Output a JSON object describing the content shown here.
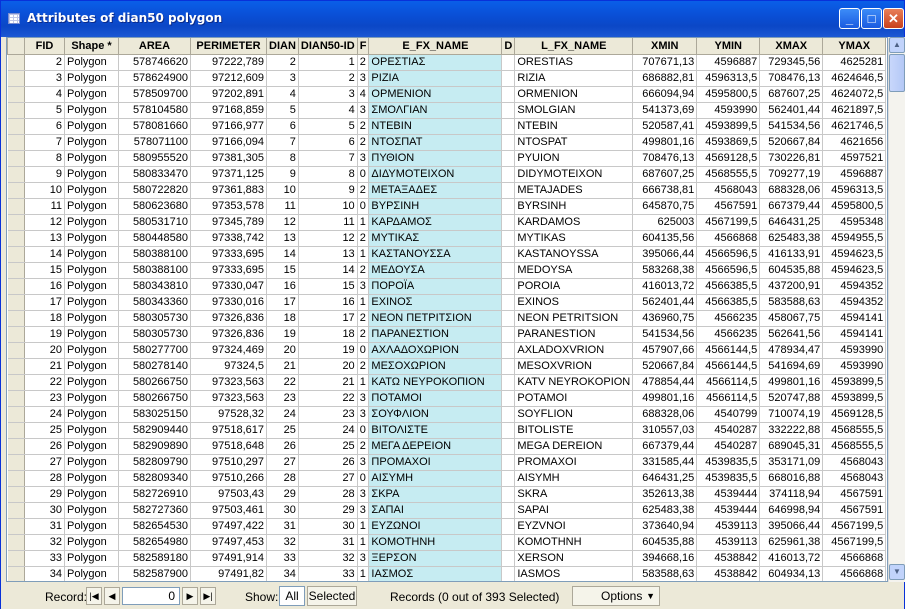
{
  "window": {
    "title": "Attributes of dian50 polygon",
    "controls": {
      "minimize": "_",
      "maximize": "□",
      "close": "✕"
    }
  },
  "colors": {
    "highlight_column": "#c6ecf2",
    "title_bar": "#0a4fd6"
  },
  "table": {
    "columns": [
      "FID",
      "Shape *",
      "AREA",
      "PERIMETER",
      "DIAN",
      "DIAN50-ID",
      "F",
      "E_FX_NAME",
      "D",
      "L_FX_NAME",
      "XMIN",
      "YMIN",
      "XMAX",
      "YMAX"
    ],
    "rows": [
      [
        "2",
        "Polygon",
        "578746620",
        "97222,789",
        "2",
        "1",
        "2",
        "ΟΡΕΣΤΙΑΣ",
        "",
        "ORESTIAS",
        "707671,13",
        "4596887",
        "729345,56",
        "4625281"
      ],
      [
        "3",
        "Polygon",
        "578624900",
        "97212,609",
        "3",
        "2",
        "3",
        "ΡΙΖΙΑ",
        "",
        "RIZIA",
        "686882,81",
        "4596313,5",
        "708476,13",
        "4624646,5"
      ],
      [
        "4",
        "Polygon",
        "578509700",
        "97202,891",
        "4",
        "3",
        "4",
        "ΟΡΜΕΝΙΟΝ",
        "",
        "ORMENION",
        "666094,94",
        "4595800,5",
        "687607,25",
        "4624072,5"
      ],
      [
        "5",
        "Polygon",
        "578104580",
        "97168,859",
        "5",
        "4",
        "3",
        "ΣΜΟΛΓΙΑΝ",
        "",
        "SMOLGIAN",
        "541373,69",
        "4593990",
        "562401,44",
        "4621897,5"
      ],
      [
        "6",
        "Polygon",
        "578081660",
        "97166,977",
        "6",
        "5",
        "2",
        "ΝΤΕΒΙΝ",
        "",
        "NTEBIN",
        "520587,41",
        "4593899,5",
        "541534,56",
        "4621746,5"
      ],
      [
        "7",
        "Polygon",
        "578071100",
        "97166,094",
        "7",
        "6",
        "2",
        "ΝΤΟΣΠΑΤ",
        "",
        "NTOSPAT",
        "499801,16",
        "4593869,5",
        "520667,84",
        "4621656"
      ],
      [
        "8",
        "Polygon",
        "580955520",
        "97381,305",
        "8",
        "7",
        "3",
        "ΠΥΘΙΟΝ",
        "",
        "PYUION",
        "708476,13",
        "4569128,5",
        "730226,81",
        "4597521"
      ],
      [
        "9",
        "Polygon",
        "580833470",
        "97371,125",
        "9",
        "8",
        "0",
        "ΔΙΔΥΜΟΤΕΙΧΟΝ",
        "",
        "DIDYMOTEIXON",
        "687607,25",
        "4568555,5",
        "709277,19",
        "4596887"
      ],
      [
        "10",
        "Polygon",
        "580722820",
        "97361,883",
        "10",
        "9",
        "2",
        "ΜΕΤΑΞΑΔΕΣ",
        "",
        "METAJADES",
        "666738,81",
        "4568043",
        "688328,06",
        "4596313,5"
      ],
      [
        "11",
        "Polygon",
        "580623680",
        "97353,578",
        "11",
        "10",
        "0",
        "ΒΥΡΣΙΝΗ",
        "",
        "BYRSINH",
        "645870,75",
        "4567591",
        "667379,44",
        "4595800,5"
      ],
      [
        "12",
        "Polygon",
        "580531710",
        "97345,789",
        "12",
        "11",
        "1",
        "ΚΑΡΔΑΜΟΣ",
        "",
        "KARDAMOS",
        "625003",
        "4567199,5",
        "646431,25",
        "4595348"
      ],
      [
        "13",
        "Polygon",
        "580448580",
        "97338,742",
        "13",
        "12",
        "2",
        "ΜΥΤΙΚΑΣ",
        "",
        "MYTIKAS",
        "604135,56",
        "4566868",
        "625483,38",
        "4594955,5"
      ],
      [
        "14",
        "Polygon",
        "580388100",
        "97333,695",
        "14",
        "13",
        "1",
        "ΚΑΣΤΑΝΟΥΣΣΑ",
        "",
        "KASTANOYSSA",
        "395066,44",
        "4566596,5",
        "416133,91",
        "4594623,5"
      ],
      [
        "15",
        "Polygon",
        "580388100",
        "97333,695",
        "15",
        "14",
        "2",
        "ΜΕΔΟΥΣΑ",
        "",
        "MEDOYSA",
        "583268,38",
        "4566596,5",
        "604535,88",
        "4594623,5"
      ],
      [
        "16",
        "Polygon",
        "580343810",
        "97330,047",
        "16",
        "15",
        "3",
        "ΠΟΡΟΪΑ",
        "",
        "POROIA",
        "416013,72",
        "4566385,5",
        "437200,91",
        "4594352"
      ],
      [
        "17",
        "Polygon",
        "580343360",
        "97330,016",
        "17",
        "16",
        "1",
        "ΕΧΙΝΟΣ",
        "",
        "EXINOS",
        "562401,44",
        "4566385,5",
        "583588,63",
        "4594352"
      ],
      [
        "18",
        "Polygon",
        "580305730",
        "97326,836",
        "18",
        "17",
        "2",
        "ΝΕΟΝ ΠΕΤΡΙΤΣΙΟΝ",
        "",
        "NEON PETRITSION",
        "436960,75",
        "4566235",
        "458067,75",
        "4594141"
      ],
      [
        "19",
        "Polygon",
        "580305730",
        "97326,836",
        "19",
        "18",
        "2",
        "ΠΑΡΑΝΕΣΤΙΟΝ",
        "",
        "PARANESTION",
        "541534,56",
        "4566235",
        "562641,56",
        "4594141"
      ],
      [
        "20",
        "Polygon",
        "580277700",
        "97324,469",
        "20",
        "19",
        "0",
        "ΑΧΛΑΔΟΧΩΡΙΟΝ",
        "",
        "AXLADOXVRION",
        "457907,66",
        "4566144,5",
        "478934,47",
        "4593990"
      ],
      [
        "21",
        "Polygon",
        "580278140",
        "97324,5",
        "21",
        "20",
        "2",
        "ΜΕΣΟΧΩΡΙΟΝ",
        "",
        "MESOXVRION",
        "520667,84",
        "4566144,5",
        "541694,69",
        "4593990"
      ],
      [
        "22",
        "Polygon",
        "580266750",
        "97323,563",
        "22",
        "21",
        "1",
        "ΚΑΤΩ ΝΕΥΡΟΚΟΠΙΟΝ",
        "",
        "KATV NEYROKOPION",
        "478854,44",
        "4566114,5",
        "499801,16",
        "4593899,5"
      ],
      [
        "23",
        "Polygon",
        "580266750",
        "97323,563",
        "23",
        "22",
        "3",
        "ΠΟΤΑΜΟΙ",
        "",
        "POTAMOI",
        "499801,16",
        "4566114,5",
        "520747,88",
        "4593899,5"
      ],
      [
        "24",
        "Polygon",
        "583025150",
        "97528,32",
        "24",
        "23",
        "3",
        "ΣΟΥΦΛΙΟΝ",
        "",
        "SOYFLION",
        "688328,06",
        "4540799",
        "710074,19",
        "4569128,5"
      ],
      [
        "25",
        "Polygon",
        "582909440",
        "97518,617",
        "25",
        "24",
        "0",
        "ΒΙΤΟΛΙΣΤΕ",
        "",
        "BITOLISTE",
        "310557,03",
        "4540287",
        "332222,88",
        "4568555,5"
      ],
      [
        "26",
        "Polygon",
        "582909890",
        "97518,648",
        "26",
        "25",
        "2",
        "ΜΕΓΑ ΔΕΡΕΙΟΝ",
        "",
        "MEGA DEREION",
        "667379,44",
        "4540287",
        "689045,31",
        "4568555,5"
      ],
      [
        "27",
        "Polygon",
        "582809790",
        "97510,297",
        "27",
        "26",
        "3",
        "ΠΡΟΜΑΧΟΙ",
        "",
        "PROMAXOI",
        "331585,44",
        "4539835,5",
        "353171,09",
        "4568043"
      ],
      [
        "28",
        "Polygon",
        "582809340",
        "97510,266",
        "28",
        "27",
        "0",
        "ΑΙΣΥΜΗ",
        "",
        "AISYMH",
        "646431,25",
        "4539835,5",
        "668016,88",
        "4568043"
      ],
      [
        "29",
        "Polygon",
        "582726910",
        "97503,43",
        "29",
        "28",
        "3",
        "ΣΚΡΑ",
        "",
        "SKRA",
        "352613,38",
        "4539444",
        "374118,94",
        "4567591"
      ],
      [
        "30",
        "Polygon",
        "582727360",
        "97503,461",
        "30",
        "29",
        "3",
        "ΣΑΠΑΙ",
        "",
        "SAPAI",
        "625483,38",
        "4539444",
        "646998,94",
        "4567591"
      ],
      [
        "31",
        "Polygon",
        "582654530",
        "97497,422",
        "31",
        "30",
        "1",
        "ΕΥΖΩΝΟΙ",
        "",
        "EYZVNOI",
        "373640,94",
        "4539113",
        "395066,44",
        "4567199,5"
      ],
      [
        "32",
        "Polygon",
        "582654980",
        "97497,453",
        "32",
        "31",
        "1",
        "ΚΟΜΟΤΗΝΗ",
        "",
        "KOMOTHNH",
        "604535,88",
        "4539113",
        "625961,38",
        "4567199,5"
      ],
      [
        "33",
        "Polygon",
        "582589180",
        "97491,914",
        "33",
        "32",
        "3",
        "ΞΕΡΣΟΝ",
        "",
        "XERSON",
        "394668,16",
        "4538842",
        "416013,72",
        "4566868"
      ],
      [
        "34",
        "Polygon",
        "582587900",
        "97491,82",
        "34",
        "33",
        "1",
        "ΙΑΣΜΟΣ",
        "",
        "IASMOS",
        "583588,63",
        "4538842",
        "604934,13",
        "4566868"
      ]
    ]
  },
  "statusbar": {
    "record_label": "Record:",
    "record_value": "0",
    "show_label": "Show:",
    "show_all": "All",
    "show_selected": "Selected",
    "records_text": "Records (0 out of 393 Selected)",
    "options": "Options"
  }
}
